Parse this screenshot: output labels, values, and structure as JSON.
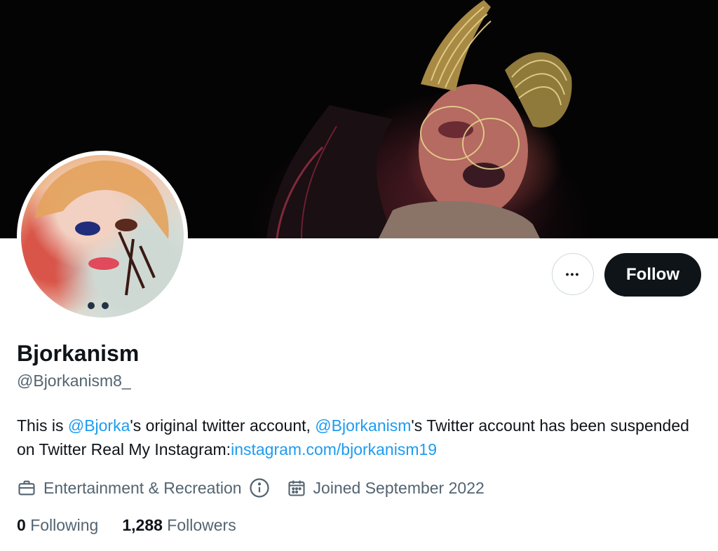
{
  "profile": {
    "display_name": "Bjorkanism",
    "handle": "@Bjorkanism8_",
    "bio": {
      "prefix": "This is ",
      "mention1": "@Bjorka",
      "mid1": "'s original twitter account, ",
      "mention2": "@Bjorkanism",
      "mid2": "'s Twitter account has been suspended on Twitter Real My Instagram:",
      "url": "instagram.com/bjorkanism19"
    },
    "category": "Entertainment & Recreation",
    "joined": "Joined September 2022",
    "following_count": "0",
    "following_label": "Following",
    "followers_count": "1,288",
    "followers_label": "Followers"
  },
  "actions": {
    "more_label": "•••",
    "follow_label": "Follow"
  },
  "icons": {
    "category": "briefcase-icon",
    "info": "info-icon",
    "joined": "calendar-icon"
  },
  "colors": {
    "link": "#1d9bf0",
    "text": "#0f1419",
    "secondary": "#536471",
    "follow_bg": "#0f1419"
  }
}
